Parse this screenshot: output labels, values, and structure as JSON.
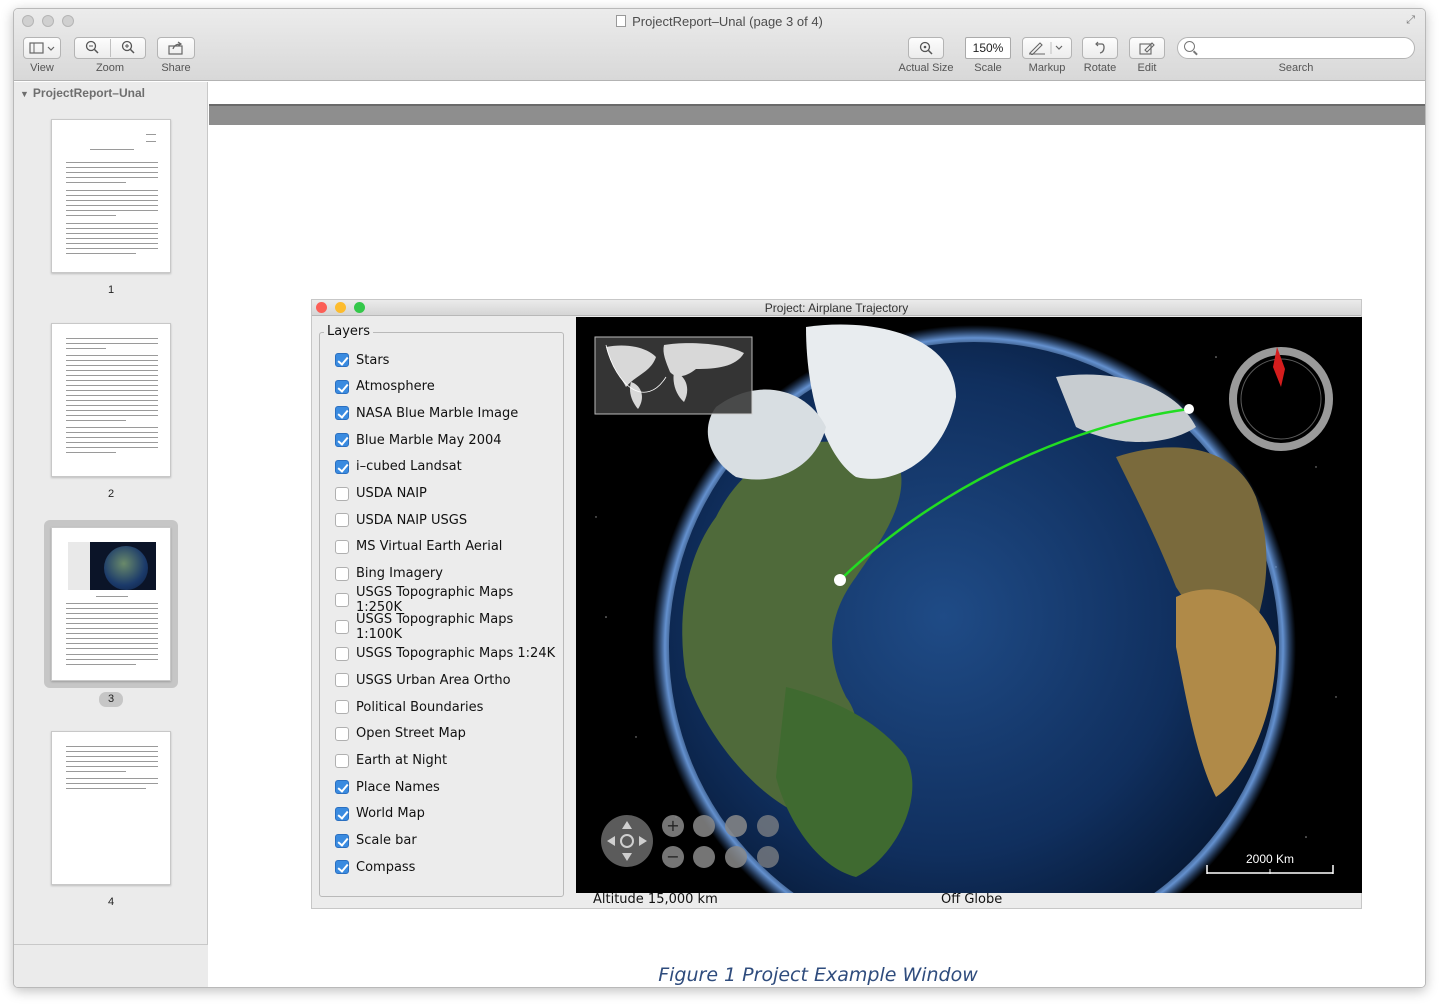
{
  "window": {
    "title": "ProjectReport–Unal (page 3 of 4)"
  },
  "toolbar": {
    "view_label": "View",
    "zoom_label": "Zoom",
    "share_label": "Share",
    "actual_size_label": "Actual Size",
    "scale_label": "Scale",
    "scale_value": "150%",
    "markup_label": "Markup",
    "rotate_label": "Rotate",
    "edit_label": "Edit",
    "search_label": "Search",
    "search_value": ""
  },
  "sidebar": {
    "title": "ProjectReport–Unal",
    "pages": [
      {
        "number": "1",
        "selected": false
      },
      {
        "number": "2",
        "selected": false
      },
      {
        "number": "3",
        "selected": true
      },
      {
        "number": "4",
        "selected": false
      }
    ]
  },
  "app": {
    "title": "Project: Airplane Trajectory",
    "layers_title": "Layers",
    "layers": [
      {
        "label": "Stars",
        "checked": true
      },
      {
        "label": "Atmosphere",
        "checked": true
      },
      {
        "label": "NASA Blue Marble Image",
        "checked": true
      },
      {
        "label": "Blue Marble May 2004",
        "checked": true
      },
      {
        "label": "i–cubed Landsat",
        "checked": true
      },
      {
        "label": "USDA NAIP",
        "checked": false
      },
      {
        "label": "USDA NAIP USGS",
        "checked": false
      },
      {
        "label": "MS Virtual Earth Aerial",
        "checked": false
      },
      {
        "label": "Bing Imagery",
        "checked": false
      },
      {
        "label": "USGS Topographic Maps 1:250K",
        "checked": false
      },
      {
        "label": "USGS Topographic Maps 1:100K",
        "checked": false
      },
      {
        "label": "USGS Topographic Maps 1:24K",
        "checked": false
      },
      {
        "label": "USGS Urban Area Ortho",
        "checked": false
      },
      {
        "label": "Political Boundaries",
        "checked": false
      },
      {
        "label": "Open Street Map",
        "checked": false
      },
      {
        "label": "Earth at Night",
        "checked": false
      },
      {
        "label": "Place Names",
        "checked": true
      },
      {
        "label": "World Map",
        "checked": true
      },
      {
        "label": "Scale bar",
        "checked": true
      },
      {
        "label": "Compass",
        "checked": true
      }
    ],
    "scale_bar_text": "2000 Km",
    "altitude_text": "Altitude  15,000 km",
    "position_text": "Off Globe"
  },
  "caption": "Figure 1 Project Example Window",
  "colors": {
    "trajectory": "#22dd22",
    "checkbox": "#3a8be0",
    "caption": "#2f4c7d",
    "close": "#fc5f57",
    "minimize": "#fdbc2e",
    "zoom": "#34c84a"
  }
}
